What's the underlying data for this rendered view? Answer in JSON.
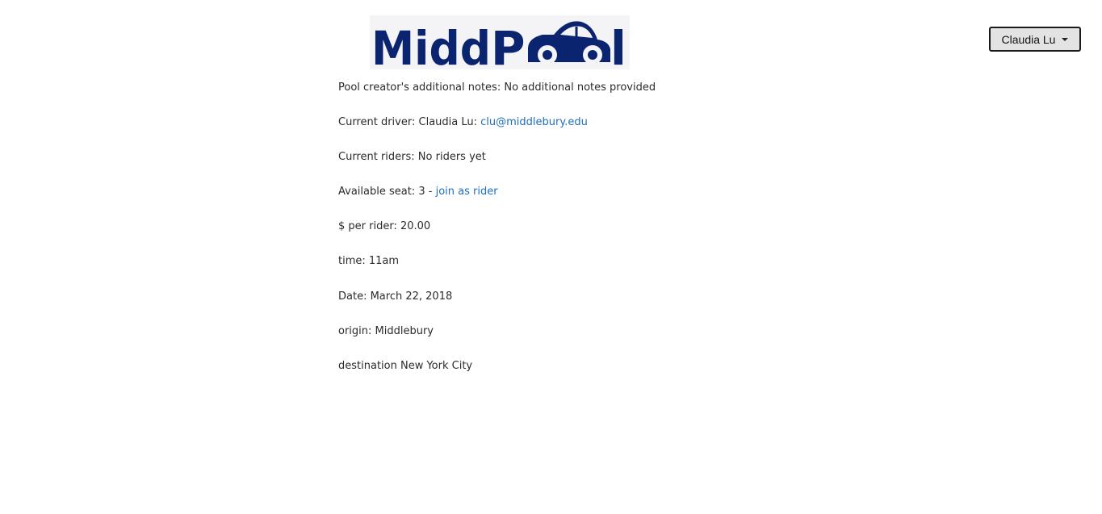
{
  "header": {
    "logo_text": "MiddPool",
    "user_menu_label": "Claudia Lu"
  },
  "colors": {
    "brand_navy": "#0b2470",
    "link_blue": "#1f6fbf",
    "text": "#2b2b2b"
  },
  "pool": {
    "notes": {
      "label": "Pool creator's additional notes: ",
      "value": "No additional notes provided"
    },
    "driver": {
      "label": "Current driver: ",
      "name": "Claudia Lu: ",
      "email": "clu@middlebury.edu"
    },
    "riders": {
      "label": "Current riders: ",
      "value": "No riders yet"
    },
    "seats": {
      "label": "Available seat: ",
      "value": "3",
      "separator": " - ",
      "join_link": "join as rider"
    },
    "price": {
      "label": "$ per rider: ",
      "value": "20.00"
    },
    "time": {
      "label": "time: ",
      "value": "11am"
    },
    "date": {
      "label": "Date: ",
      "value": "March 22, 2018"
    },
    "origin": {
      "label": "origin: ",
      "value": "Middlebury"
    },
    "destination": {
      "label": "destination ",
      "value": "New York City"
    }
  }
}
